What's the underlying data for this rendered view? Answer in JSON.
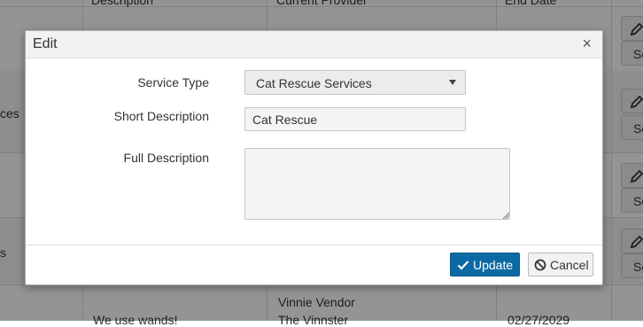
{
  "background": {
    "headers": [
      "Description",
      "Current Provider",
      "End Date"
    ],
    "row_fragments": [
      "ces",
      "s"
    ],
    "last_row": {
      "description": "We use wands!",
      "provider_line1": "Vinnie Vendor",
      "provider_line2": "The Vinnster",
      "end_date": "02/27/2029"
    },
    "select_button_label": "Se"
  },
  "modal": {
    "title": "Edit",
    "close_glyph": "×",
    "fields": {
      "service_type": {
        "label": "Service Type",
        "value": "Cat Rescue Services"
      },
      "short_description": {
        "label": "Short Description",
        "value": "Cat Rescue"
      },
      "full_description": {
        "label": "Full Description",
        "value": ""
      }
    },
    "buttons": {
      "update": "Update",
      "cancel": "Cancel"
    }
  },
  "colors": {
    "primary": "#0b6aa3",
    "overlay": "rgba(0,0,0,0.42)"
  },
  "icons": [
    "pencil-icon",
    "chevron-down-icon",
    "close-icon",
    "check-icon",
    "ban-icon",
    "resize-grip-icon"
  ]
}
